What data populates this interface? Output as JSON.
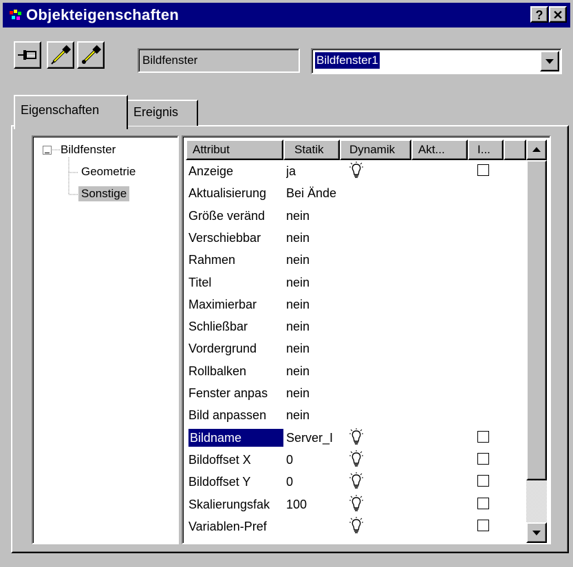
{
  "window": {
    "title": "Objekteigenschaften",
    "help_label": "?",
    "close_label": "✕"
  },
  "toolbar": {
    "pin_icon": "pin-icon",
    "object_type": "Bildfenster",
    "object_name": "Bildfenster1"
  },
  "tabs": [
    {
      "label": "Eigenschaften"
    },
    {
      "label": "Ereignis"
    }
  ],
  "tree": {
    "root": "Bildfenster",
    "children": [
      "Geometrie",
      "Sonstige"
    ],
    "selected": "Sonstige"
  },
  "grid": {
    "headers": [
      "Attribut",
      "Statik",
      "Dynamik",
      "Akt...",
      "I..."
    ],
    "rows": [
      {
        "attr": "Anzeige",
        "statik": "ja"
      },
      {
        "attr": "Aktualisierung",
        "statik": "Bei Ände"
      },
      {
        "attr": "Größe veränd",
        "statik": "nein"
      },
      {
        "attr": "Verschiebbar",
        "statik": "nein"
      },
      {
        "attr": "Rahmen",
        "statik": "nein"
      },
      {
        "attr": "Titel",
        "statik": "nein"
      },
      {
        "attr": "Maximierbar",
        "statik": "nein"
      },
      {
        "attr": "Schließbar",
        "statik": "nein"
      },
      {
        "attr": "Vordergrund",
        "statik": "nein"
      },
      {
        "attr": "Rollbalken",
        "statik": "nein"
      },
      {
        "attr": "Fenster anpas",
        "statik": "nein"
      },
      {
        "attr": "Bild anpassen",
        "statik": "nein"
      },
      {
        "attr": "Bildname",
        "statik": "Server_I"
      },
      {
        "attr": "Bildoffset X",
        "statik": "0"
      },
      {
        "attr": "Bildoffset Y",
        "statik": "0"
      },
      {
        "attr": "Skalierungsfak",
        "statik": "100"
      },
      {
        "attr": "Variablen-Pref",
        "statik": ""
      }
    ]
  }
}
